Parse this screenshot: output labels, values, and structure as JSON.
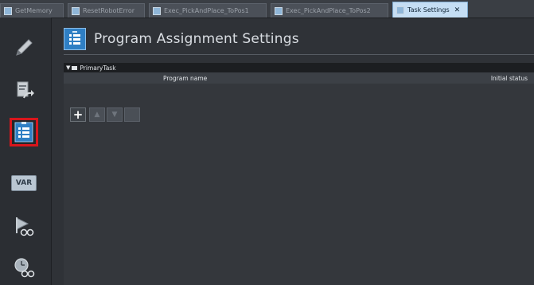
{
  "tabs": [
    {
      "label": "GetMemory",
      "active": false
    },
    {
      "label": "ResetRobotError",
      "active": false
    },
    {
      "label": "Exec_PickAndPlace_ToPos1",
      "active": false
    },
    {
      "label": "Exec_PickAndPlace_ToPos2",
      "active": false
    },
    {
      "label": "Task Settings",
      "active": true,
      "close": "✕"
    }
  ],
  "sidebar": {
    "items": [
      {
        "name": "edit-pencil",
        "icon": "pencil-icon",
        "selected": false
      },
      {
        "name": "io-map",
        "icon": "document-arrow-icon",
        "selected": false
      },
      {
        "name": "program-assignment",
        "icon": "list-icon",
        "selected": true
      },
      {
        "name": "variables",
        "icon": "var-icon",
        "label": "VAR",
        "selected": false
      },
      {
        "name": "task-monitor",
        "icon": "flag-glasses-icon",
        "selected": false
      },
      {
        "name": "task-timing",
        "icon": "clock-glasses-icon",
        "selected": false
      }
    ]
  },
  "page": {
    "title": "Program Assignment Settings"
  },
  "task": {
    "name": "PrimaryTask",
    "expander": "▼",
    "columns": {
      "program": "Program name",
      "status": "Initial status"
    }
  },
  "toolbar": {
    "add": "+",
    "move_up": "▲",
    "move_down": "▼",
    "delete": ""
  },
  "colors": {
    "accent": "#2f7fc4",
    "selection_border": "#d8161c",
    "active_tab": "#c5def4",
    "background": "#2f3237"
  }
}
